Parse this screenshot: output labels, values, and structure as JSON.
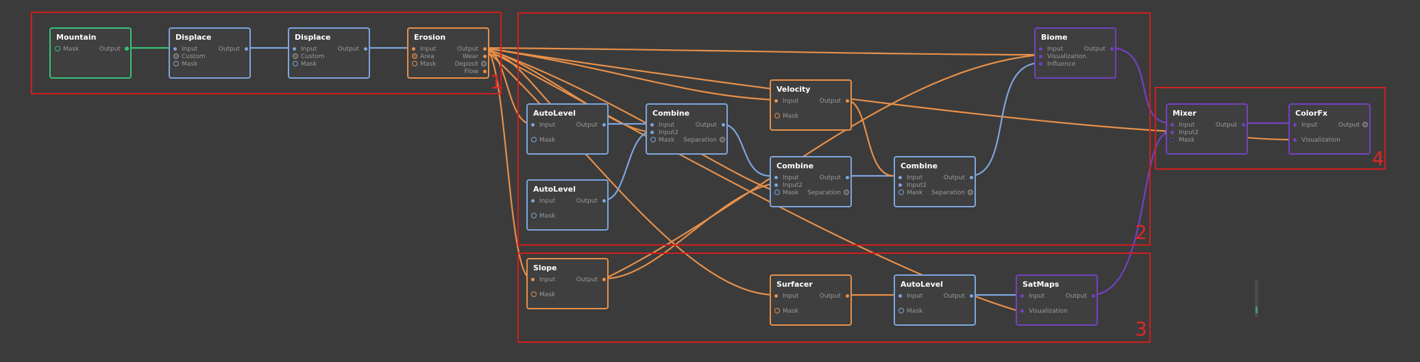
{
  "app": {
    "view": "node-graph-editor"
  },
  "colors": {
    "background": "#3b3b3b",
    "region_border": "#d21e1e",
    "wire_green": "#39c27a",
    "wire_blue": "#7ea6df",
    "wire_orange": "#e8904a",
    "wire_purple": "#7441c2"
  },
  "regions": [
    {
      "label": "1"
    },
    {
      "label": "2"
    },
    {
      "label": "3"
    },
    {
      "label": "4"
    }
  ],
  "nodes": {
    "mountain": {
      "title": "Mountain",
      "inputs": [
        "Mask"
      ],
      "outputs": [
        "Output"
      ]
    },
    "displace1": {
      "title": "Displace",
      "inputs": [
        "Input",
        "Custom",
        "Mask"
      ],
      "outputs": [
        "Output"
      ]
    },
    "displace2": {
      "title": "Displace",
      "inputs": [
        "Input",
        "Custom",
        "Mask"
      ],
      "outputs": [
        "Output"
      ]
    },
    "erosion": {
      "title": "Erosion",
      "inputs": [
        "Input",
        "Area",
        "Mask"
      ],
      "outputs": [
        "Output",
        "Wear",
        "Deposit",
        "Flow"
      ]
    },
    "autolevel1": {
      "title": "AutoLevel",
      "inputs": [
        "Input",
        "Mask"
      ],
      "outputs": [
        "Output"
      ]
    },
    "autolevel2": {
      "title": "AutoLevel",
      "inputs": [
        "Input",
        "Mask"
      ],
      "outputs": [
        "Output"
      ]
    },
    "combine1": {
      "title": "Combine",
      "inputs": [
        "Input",
        "Input2",
        "Mask"
      ],
      "outputs": [
        "Output",
        "Separation"
      ]
    },
    "velocity": {
      "title": "Velocity",
      "inputs": [
        "Input",
        "Mask"
      ],
      "outputs": [
        "Output"
      ]
    },
    "combine2": {
      "title": "Combine",
      "inputs": [
        "Input",
        "Input2",
        "Mask"
      ],
      "outputs": [
        "Output",
        "Separation"
      ]
    },
    "combine3": {
      "title": "Combine",
      "inputs": [
        "Input",
        "Input2",
        "Mask"
      ],
      "outputs": [
        "Output",
        "Separation"
      ]
    },
    "biome": {
      "title": "Biome",
      "inputs": [
        "Input",
        "Visualization",
        "Influence"
      ],
      "outputs": [
        "Output"
      ]
    },
    "slope": {
      "title": "Slope",
      "inputs": [
        "Input",
        "Mask"
      ],
      "outputs": [
        "Output"
      ]
    },
    "surfacer": {
      "title": "Surfacer",
      "inputs": [
        "Input",
        "Mask"
      ],
      "outputs": [
        "Output"
      ]
    },
    "autolevel3": {
      "title": "AutoLevel",
      "inputs": [
        "Input",
        "Mask"
      ],
      "outputs": [
        "Output"
      ]
    },
    "satmaps": {
      "title": "SatMaps",
      "inputs": [
        "Input",
        "Visualization"
      ],
      "outputs": [
        "Output"
      ]
    },
    "mixer": {
      "title": "Mixer",
      "inputs": [
        "Input",
        "Input2",
        "Mask"
      ],
      "outputs": [
        "Output"
      ]
    },
    "colorfx": {
      "title": "ColorFx",
      "inputs": [
        "Input",
        "Visualization"
      ],
      "outputs": [
        "Output"
      ]
    }
  }
}
